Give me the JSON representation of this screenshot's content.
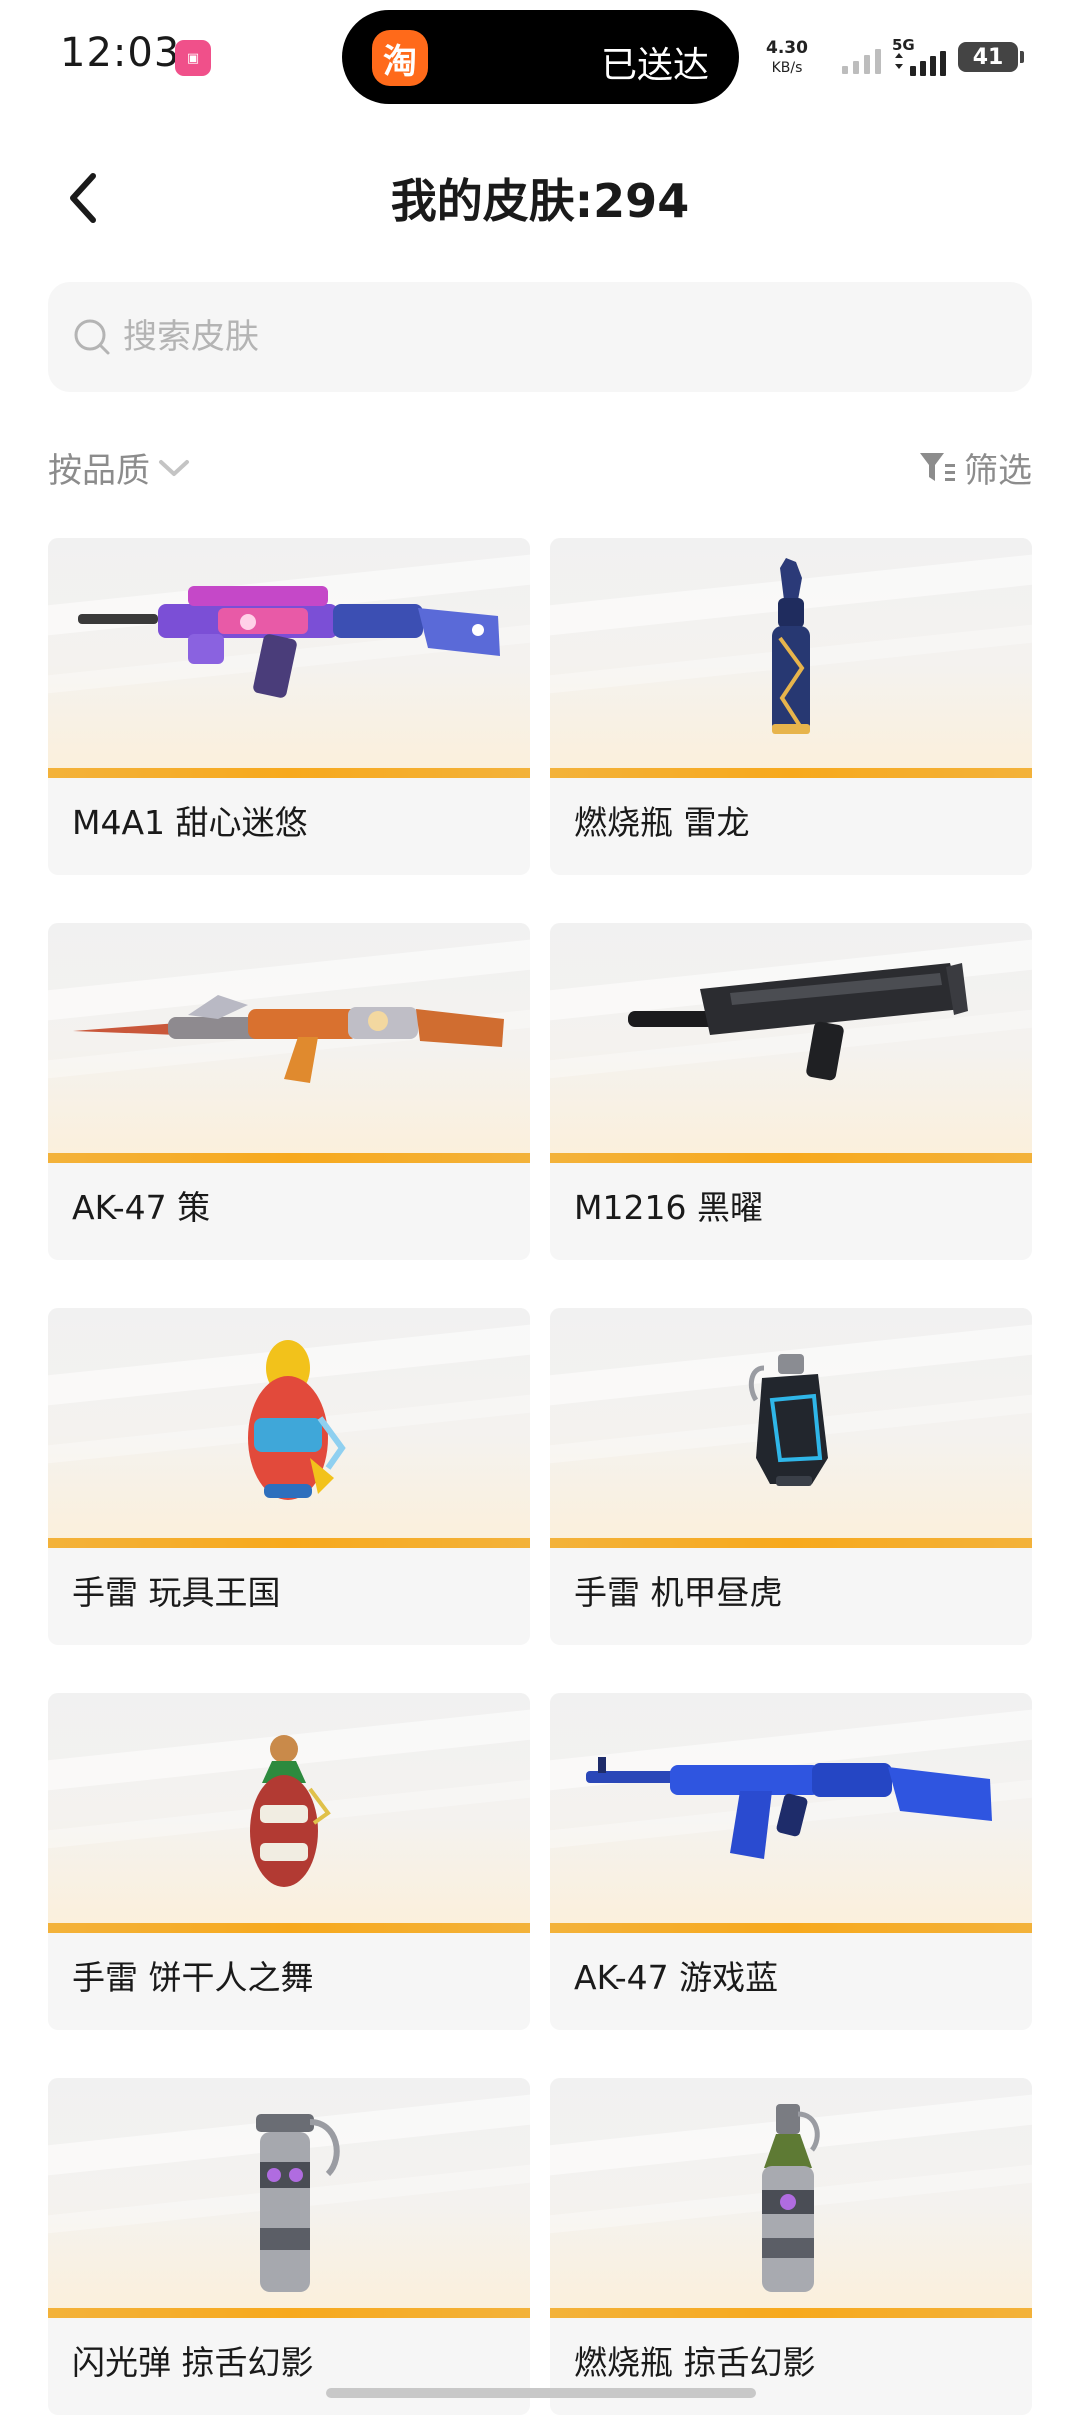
{
  "status_bar": {
    "time": "12:03",
    "island_badge": "淘",
    "island_text": "已送达",
    "net_speed_value": "4.30",
    "net_speed_unit": "KB/s",
    "network_type": "5G",
    "battery": "41"
  },
  "header": {
    "title": "我的皮肤:294"
  },
  "search": {
    "placeholder": "搜索皮肤",
    "value": ""
  },
  "toolbar": {
    "sort_label": "按品质",
    "filter_label": "筛选"
  },
  "colors": {
    "quality_gold": "#f7a91d",
    "card_bg": "#f6f6f6",
    "taobao_orange": "#ff6a1a"
  },
  "skins": [
    {
      "name": "M4A1 甜心迷悠",
      "icon": "rifle-pink-skin"
    },
    {
      "name": "燃烧瓶 雷龙",
      "icon": "molotov-dragon-skin"
    },
    {
      "name": "AK-47 策",
      "icon": "rifle-orange-skin"
    },
    {
      "name": "M1216 黑曜",
      "icon": "shotgun-black-skin"
    },
    {
      "name": "手雷 玩具王国",
      "icon": "grenade-toy-skin"
    },
    {
      "name": "手雷 机甲昼虎",
      "icon": "grenade-mecha-skin"
    },
    {
      "name": "手雷 饼干人之舞",
      "icon": "grenade-gingerbread-skin"
    },
    {
      "name": "AK-47 游戏蓝",
      "icon": "rifle-blue-skin"
    },
    {
      "name": "闪光弹 掠舌幻影",
      "icon": "flashbang-phantom-skin"
    },
    {
      "name": "燃烧瓶 掠舌幻影",
      "icon": "molotov-phantom-skin"
    }
  ]
}
